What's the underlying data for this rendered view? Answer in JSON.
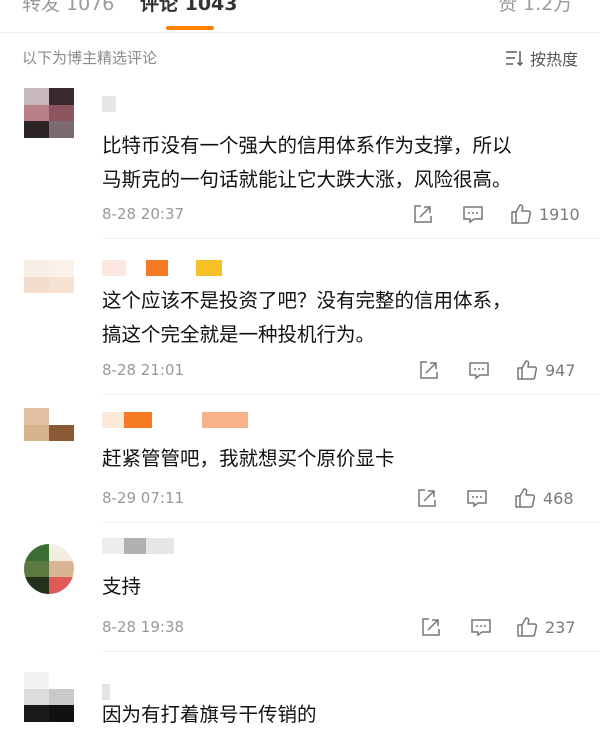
{
  "tabs": [
    {
      "label": "转发 1076"
    },
    {
      "label": "评论 1043"
    },
    {
      "label": "赞 1.2万"
    }
  ],
  "accent_color": "#ff8200",
  "sub_note": "以下为博主精选评论",
  "sort_label": "按热度",
  "sort_icon": "sort-lines-icon",
  "comments": [
    {
      "lines": [
        "比特币没有一个强大的信用体系作为支撑，所以",
        "马斯克的一句话就能让它大跌大涨，风险很高。"
      ],
      "time": "8-28 20:37",
      "likes": "1910"
    },
    {
      "lines": [
        "这个应该不是投资了吧？没有完整的信用体系，",
        "搞这个完全就是一种投机行为。"
      ],
      "time": "8-28 21:01",
      "likes": "947"
    },
    {
      "lines": [
        "赶紧管管吧，我就想买个原价显卡"
      ],
      "time": "8-29 07:11",
      "likes": "468"
    },
    {
      "lines": [
        "支持"
      ],
      "time": "8-28 19:38",
      "likes": "237"
    },
    {
      "lines": [
        "因为有打着旗号干传销的"
      ]
    }
  ]
}
